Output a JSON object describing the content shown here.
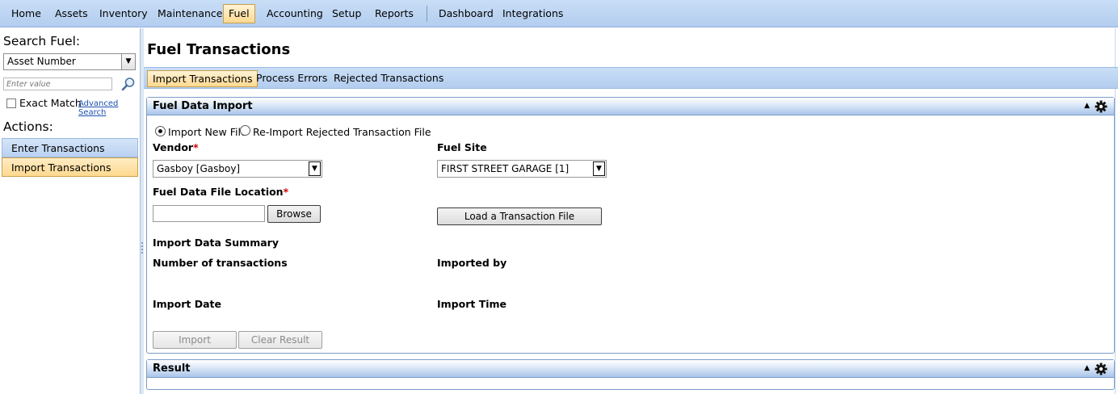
{
  "menu": {
    "items": [
      {
        "label": "Home"
      },
      {
        "label": "Assets"
      },
      {
        "label": "Inventory"
      },
      {
        "label": "Maintenance"
      },
      {
        "label": "Fuel",
        "active": true
      },
      {
        "label": "Accounting"
      },
      {
        "label": "Setup"
      },
      {
        "label": "Reports"
      },
      {
        "label": "Dashboard"
      },
      {
        "label": "Integrations"
      }
    ]
  },
  "sidebar": {
    "search_title": "Search Fuel:",
    "search_field": "Asset Number",
    "search_placeholder": "Enter value",
    "exact_match": "Exact Match",
    "advanced_search": "Advanced Search",
    "actions_title": "Actions:",
    "actions": [
      {
        "label": "Enter Transactions"
      },
      {
        "label": "Import Transactions",
        "active": true
      }
    ]
  },
  "main": {
    "title": "Fuel Transactions",
    "tabs": [
      {
        "label": "Import Transactions",
        "active": true
      },
      {
        "label": "Process Errors"
      },
      {
        "label": "Rejected Transactions"
      }
    ]
  },
  "import_panel": {
    "title": "Fuel Data Import",
    "radio_new": "Import New File",
    "radio_reimport": "Re-Import Rejected Transaction File",
    "vendor_label": "Vendor",
    "required_mark": "*",
    "vendor_value": "Gasboy [Gasboy]",
    "fuel_site_label": "Fuel Site",
    "fuel_site_value": "FIRST STREET GARAGE [1]",
    "file_location_label": "Fuel Data File Location",
    "file_location_value": "",
    "browse_button": "Browse",
    "load_button": "Load a Transaction File",
    "summary_title": "Import Data Summary",
    "num_transactions_label": "Number of transactions",
    "imported_by_label": "Imported by",
    "import_date_label": "Import Date",
    "import_time_label": "Import Time",
    "import_button": "Import",
    "clear_button": "Clear Result"
  },
  "result_panel": {
    "title": "Result"
  }
}
